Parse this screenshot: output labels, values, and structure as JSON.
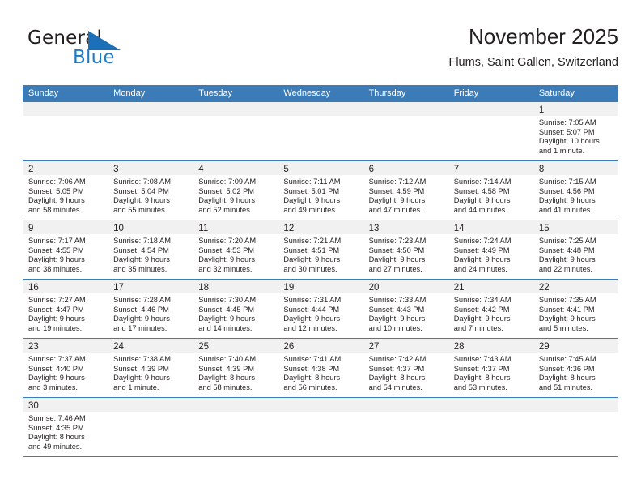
{
  "brand": {
    "name_top": "General",
    "name_bottom": "Blue",
    "accent_color": "#1d7cc4",
    "logo_icon": "triangle-flag-icon"
  },
  "header": {
    "title": "November 2025",
    "subtitle": "Flums, Saint Gallen, Switzerland"
  },
  "theme": {
    "header_bar_color": "#3b7cb8",
    "daynum_bar_color": "#f1f1f1",
    "week_divider_color": "#3b7cb8",
    "text_color": "#231f20"
  },
  "weekday_headers": [
    "Sunday",
    "Monday",
    "Tuesday",
    "Wednesday",
    "Thursday",
    "Friday",
    "Saturday"
  ],
  "weeks": [
    [
      {
        "day": "",
        "lines": []
      },
      {
        "day": "",
        "lines": []
      },
      {
        "day": "",
        "lines": []
      },
      {
        "day": "",
        "lines": []
      },
      {
        "day": "",
        "lines": []
      },
      {
        "day": "",
        "lines": []
      },
      {
        "day": "1",
        "lines": [
          "Sunrise: 7:05 AM",
          "Sunset: 5:07 PM",
          "Daylight: 10 hours",
          "and 1 minute."
        ]
      }
    ],
    [
      {
        "day": "2",
        "lines": [
          "Sunrise: 7:06 AM",
          "Sunset: 5:05 PM",
          "Daylight: 9 hours",
          "and 58 minutes."
        ]
      },
      {
        "day": "3",
        "lines": [
          "Sunrise: 7:08 AM",
          "Sunset: 5:04 PM",
          "Daylight: 9 hours",
          "and 55 minutes."
        ]
      },
      {
        "day": "4",
        "lines": [
          "Sunrise: 7:09 AM",
          "Sunset: 5:02 PM",
          "Daylight: 9 hours",
          "and 52 minutes."
        ]
      },
      {
        "day": "5",
        "lines": [
          "Sunrise: 7:11 AM",
          "Sunset: 5:01 PM",
          "Daylight: 9 hours",
          "and 49 minutes."
        ]
      },
      {
        "day": "6",
        "lines": [
          "Sunrise: 7:12 AM",
          "Sunset: 4:59 PM",
          "Daylight: 9 hours",
          "and 47 minutes."
        ]
      },
      {
        "day": "7",
        "lines": [
          "Sunrise: 7:14 AM",
          "Sunset: 4:58 PM",
          "Daylight: 9 hours",
          "and 44 minutes."
        ]
      },
      {
        "day": "8",
        "lines": [
          "Sunrise: 7:15 AM",
          "Sunset: 4:56 PM",
          "Daylight: 9 hours",
          "and 41 minutes."
        ]
      }
    ],
    [
      {
        "day": "9",
        "lines": [
          "Sunrise: 7:17 AM",
          "Sunset: 4:55 PM",
          "Daylight: 9 hours",
          "and 38 minutes."
        ]
      },
      {
        "day": "10",
        "lines": [
          "Sunrise: 7:18 AM",
          "Sunset: 4:54 PM",
          "Daylight: 9 hours",
          "and 35 minutes."
        ]
      },
      {
        "day": "11",
        "lines": [
          "Sunrise: 7:20 AM",
          "Sunset: 4:53 PM",
          "Daylight: 9 hours",
          "and 32 minutes."
        ]
      },
      {
        "day": "12",
        "lines": [
          "Sunrise: 7:21 AM",
          "Sunset: 4:51 PM",
          "Daylight: 9 hours",
          "and 30 minutes."
        ]
      },
      {
        "day": "13",
        "lines": [
          "Sunrise: 7:23 AM",
          "Sunset: 4:50 PM",
          "Daylight: 9 hours",
          "and 27 minutes."
        ]
      },
      {
        "day": "14",
        "lines": [
          "Sunrise: 7:24 AM",
          "Sunset: 4:49 PM",
          "Daylight: 9 hours",
          "and 24 minutes."
        ]
      },
      {
        "day": "15",
        "lines": [
          "Sunrise: 7:25 AM",
          "Sunset: 4:48 PM",
          "Daylight: 9 hours",
          "and 22 minutes."
        ]
      }
    ],
    [
      {
        "day": "16",
        "lines": [
          "Sunrise: 7:27 AM",
          "Sunset: 4:47 PM",
          "Daylight: 9 hours",
          "and 19 minutes."
        ]
      },
      {
        "day": "17",
        "lines": [
          "Sunrise: 7:28 AM",
          "Sunset: 4:46 PM",
          "Daylight: 9 hours",
          "and 17 minutes."
        ]
      },
      {
        "day": "18",
        "lines": [
          "Sunrise: 7:30 AM",
          "Sunset: 4:45 PM",
          "Daylight: 9 hours",
          "and 14 minutes."
        ]
      },
      {
        "day": "19",
        "lines": [
          "Sunrise: 7:31 AM",
          "Sunset: 4:44 PM",
          "Daylight: 9 hours",
          "and 12 minutes."
        ]
      },
      {
        "day": "20",
        "lines": [
          "Sunrise: 7:33 AM",
          "Sunset: 4:43 PM",
          "Daylight: 9 hours",
          "and 10 minutes."
        ]
      },
      {
        "day": "21",
        "lines": [
          "Sunrise: 7:34 AM",
          "Sunset: 4:42 PM",
          "Daylight: 9 hours",
          "and 7 minutes."
        ]
      },
      {
        "day": "22",
        "lines": [
          "Sunrise: 7:35 AM",
          "Sunset: 4:41 PM",
          "Daylight: 9 hours",
          "and 5 minutes."
        ]
      }
    ],
    [
      {
        "day": "23",
        "lines": [
          "Sunrise: 7:37 AM",
          "Sunset: 4:40 PM",
          "Daylight: 9 hours",
          "and 3 minutes."
        ]
      },
      {
        "day": "24",
        "lines": [
          "Sunrise: 7:38 AM",
          "Sunset: 4:39 PM",
          "Daylight: 9 hours",
          "and 1 minute."
        ]
      },
      {
        "day": "25",
        "lines": [
          "Sunrise: 7:40 AM",
          "Sunset: 4:39 PM",
          "Daylight: 8 hours",
          "and 58 minutes."
        ]
      },
      {
        "day": "26",
        "lines": [
          "Sunrise: 7:41 AM",
          "Sunset: 4:38 PM",
          "Daylight: 8 hours",
          "and 56 minutes."
        ]
      },
      {
        "day": "27",
        "lines": [
          "Sunrise: 7:42 AM",
          "Sunset: 4:37 PM",
          "Daylight: 8 hours",
          "and 54 minutes."
        ]
      },
      {
        "day": "28",
        "lines": [
          "Sunrise: 7:43 AM",
          "Sunset: 4:37 PM",
          "Daylight: 8 hours",
          "and 53 minutes."
        ]
      },
      {
        "day": "29",
        "lines": [
          "Sunrise: 7:45 AM",
          "Sunset: 4:36 PM",
          "Daylight: 8 hours",
          "and 51 minutes."
        ]
      }
    ],
    [
      {
        "day": "30",
        "lines": [
          "Sunrise: 7:46 AM",
          "Sunset: 4:35 PM",
          "Daylight: 8 hours",
          "and 49 minutes."
        ]
      },
      {
        "day": "",
        "lines": []
      },
      {
        "day": "",
        "lines": []
      },
      {
        "day": "",
        "lines": []
      },
      {
        "day": "",
        "lines": []
      },
      {
        "day": "",
        "lines": []
      },
      {
        "day": "",
        "lines": []
      }
    ]
  ]
}
